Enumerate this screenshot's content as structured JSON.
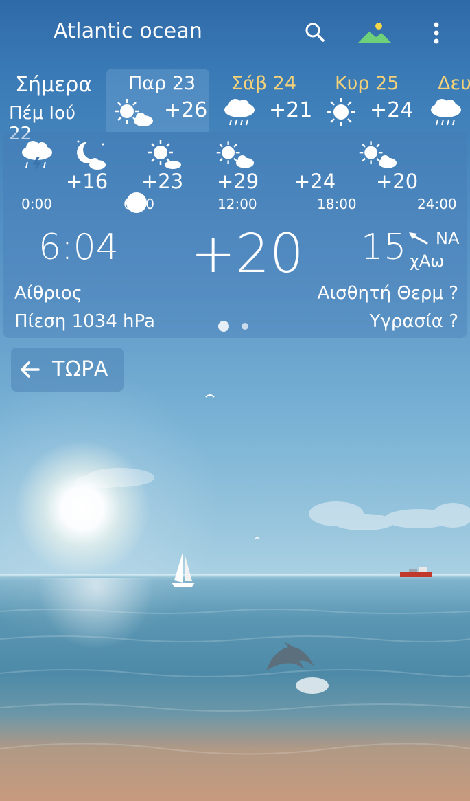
{
  "header": {
    "title": "Atlantic ocean"
  },
  "days": {
    "today": {
      "name": "Σήμερα",
      "date": "Πέμ Ιού 22"
    },
    "fri": {
      "name": "Παρ 23",
      "temp": "+26"
    },
    "sat": {
      "name": "Σάβ 24",
      "temp": "+21"
    },
    "sun": {
      "name": "Κυρ 25",
      "temp": "+24"
    },
    "mon": {
      "name": "Δευ"
    }
  },
  "hourly": {
    "temps": [
      "+16",
      "+23",
      "+29",
      "+24",
      "+20"
    ],
    "times": [
      "0:00",
      "6:00",
      "12:00",
      "18:00",
      "24:00"
    ]
  },
  "current": {
    "sunrise": "6:04",
    "temp": "+20",
    "wind_speed": "15",
    "wind_dir": "ΝΑ",
    "wind_name": "χΑω",
    "condition": "Αίθριος",
    "feels_like": "Αισθητή Θερμ ?",
    "pressure": "Πίεση 1034 hPa",
    "humidity": "Υγρασία ?"
  },
  "now_button": {
    "label": "ΤΩΡΑ"
  },
  "colors": {
    "day_name_accent": "#f5d27a",
    "text": "#ffffff"
  }
}
